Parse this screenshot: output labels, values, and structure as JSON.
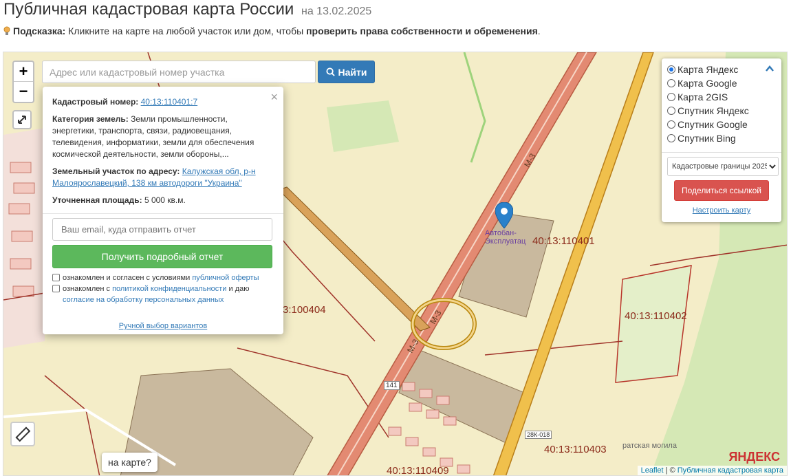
{
  "header": {
    "title": "Публичная кадастровая карта России",
    "date": "на 13.02.2025",
    "hint_label": "Подсказка:",
    "hint_text": " Кликните на карте на любой участок или дом, чтобы ",
    "hint_bold": "проверить права собственности и обременения",
    "hint_end": "."
  },
  "controls": {
    "zoom_in": "+",
    "zoom_out": "−"
  },
  "search": {
    "placeholder": "Адрес или кадастровый номер участка",
    "button_label": "Найти"
  },
  "popup": {
    "cadastral_label": "Кадастровый номер:",
    "cadastral_value": "40:13:110401:7",
    "category_label": "Категория земель:",
    "category_value": "Земли промышленности, энергетики, транспорта, связи, радиовещания, телевидения, информатики, земли для обеспечения космической деятельности, земли обороны,...",
    "address_label": "Земельный участок по адресу:",
    "address_value": "Калужская обл, р-н Малоярославецкий, 138 км автодороги \"Украина\"",
    "area_label": "Уточненная площадь:",
    "area_value": "5 000 кв.м.",
    "email_placeholder": "Ваш email, куда отправить отчет",
    "report_button": "Получить подробный отчет",
    "agree1_text": "ознакомлен и согласен с условиями ",
    "agree1_link": "публичной оферты",
    "agree2_text": "ознакомлен с ",
    "agree2_link": "политикой конфиденциальности",
    "agree2_mid": " и даю ",
    "agree2_link2": "согласие на обработку персональных данных",
    "manual_link": "Ручной выбор вариантов",
    "close": "×"
  },
  "layers": {
    "options": [
      {
        "label": "Карта Яндекс",
        "selected": true
      },
      {
        "label": "Карта Google",
        "selected": false
      },
      {
        "label": "Карта 2GIS",
        "selected": false
      },
      {
        "label": "Спутник Яндекс",
        "selected": false
      },
      {
        "label": "Спутник Google",
        "selected": false
      },
      {
        "label": "Спутник Bing",
        "selected": false
      }
    ],
    "select_value": "Кадастровые границы 2025",
    "share_button": "Поделиться ссылкой",
    "config_link": "Настроить карту"
  },
  "map": {
    "labels": {
      "parcel_110401": "40:13:110401",
      "parcel_110404": "3:100404",
      "parcel_110402": "40:13:110402",
      "parcel_110403": "40:13:110403",
      "parcel_110409": "40:13:110409",
      "road_m3_a": "М-3",
      "road_m3_b": "М-3",
      "road_m3_c": "М-3",
      "poi_autobahn": "Автобан-Эксплуатац",
      "poi_grave": "ратская могила",
      "road_141": "141",
      "road_2n": "28К-018"
    },
    "help_tip": "на карте?",
    "yandex": "ЯНДЕКС",
    "attribution_leaflet": "Leaflet",
    "attribution_sep": " | © ",
    "attribution_link": "Публичная кадастровая карта"
  },
  "colors": {
    "accent_blue": "#337ab7",
    "green_button": "#5cb85c",
    "red_button": "#d9534f",
    "parcel_border": "#8b2a1a",
    "road": "#e07a5f"
  }
}
